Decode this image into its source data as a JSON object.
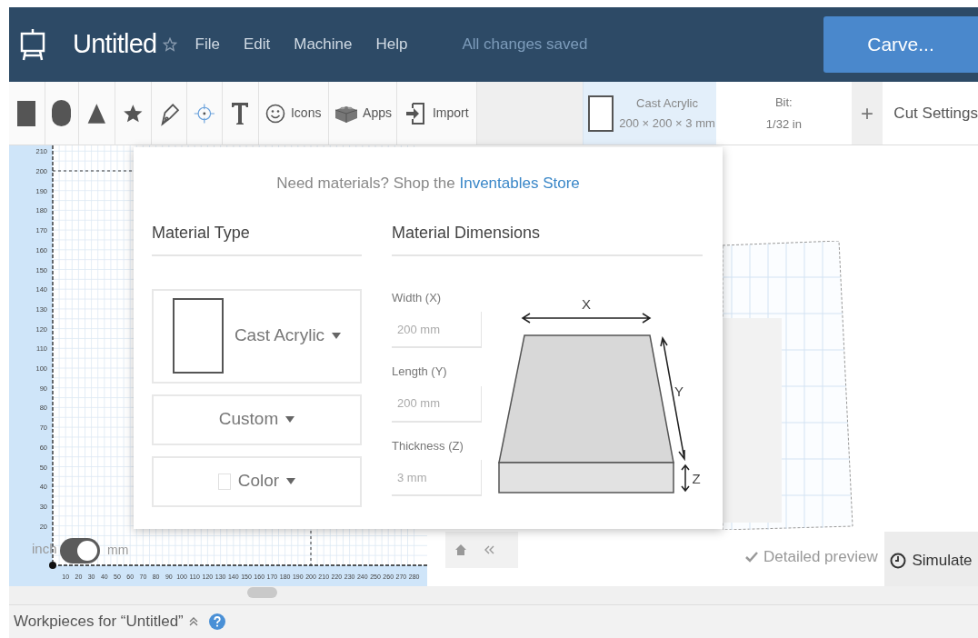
{
  "header": {
    "title": "Untitled",
    "menu": [
      "File",
      "Edit",
      "Machine",
      "Help"
    ],
    "save_status": "All changes saved",
    "carve_button": "Carve..."
  },
  "toolbar": {
    "tools": [
      {
        "label": "Icons"
      },
      {
        "label": "Apps"
      },
      {
        "label": "Import"
      }
    ],
    "material": {
      "name": "Cast Acrylic",
      "dimensions": "200 × 200 × 3 mm"
    },
    "bit": {
      "label": "Bit:",
      "value": "1/32 in"
    },
    "add_button": "+",
    "cut_settings": "Cut Settings"
  },
  "material_popover": {
    "shop_text": "Need materials? Shop the",
    "shop_link": "Inventables Store",
    "material_type": {
      "heading": "Material Type",
      "dropdowns": [
        "Cast Acrylic",
        "Custom",
        "Color"
      ]
    },
    "material_dimensions": {
      "heading": "Material Dimensions",
      "fields": [
        {
          "label": "Width (X)",
          "value": "200 mm"
        },
        {
          "label": "Length (Y)",
          "value": "200 mm"
        },
        {
          "label": "Thickness (Z)",
          "value": "3 mm"
        }
      ],
      "axis_labels": [
        "X",
        "Y",
        "Z"
      ]
    }
  },
  "canvas": {
    "y_ticks": [
      "210",
      "200",
      "190",
      "180",
      "170",
      "160",
      "150",
      "140",
      "130",
      "120",
      "110",
      "100",
      "90",
      "80",
      "70",
      "60",
      "50",
      "40",
      "30",
      "20"
    ],
    "x_ticks": [
      "10",
      "20",
      "30",
      "40",
      "50",
      "60",
      "70",
      "80",
      "90",
      "100",
      "110",
      "120",
      "130",
      "140",
      "150",
      "160",
      "170",
      "180",
      "190",
      "200",
      "210",
      "220",
      "230",
      "240",
      "250",
      "260",
      "270",
      "280"
    ],
    "unit_toggle": {
      "left_label": "inch",
      "right_label": "mm",
      "on": true
    }
  },
  "preview": {
    "detailed_preview": {
      "label": "Detailed preview",
      "checked": true
    },
    "simulate_button": "Simulate"
  },
  "workpieces": {
    "title": "Workpieces for “Untitled”"
  }
}
